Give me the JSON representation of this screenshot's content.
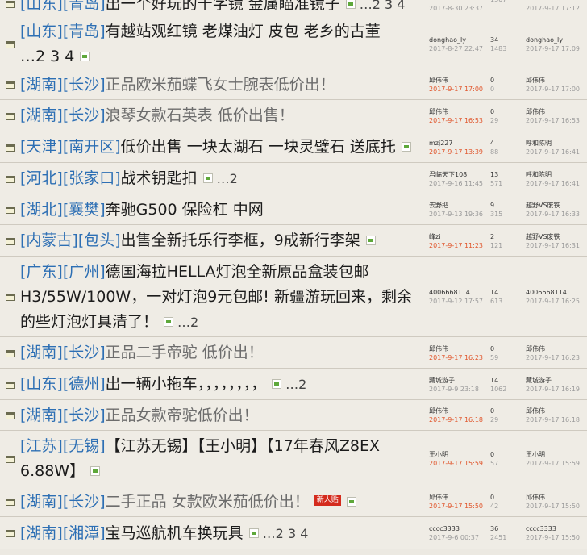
{
  "threads": [
    {
      "regions": [
        "[山东]",
        "[青岛]"
      ],
      "lines": [
        "出一个好玩的千字镜 金属瞄准镜子"
      ],
      "img": true,
      "pages": "…2 3 4",
      "author": "",
      "post_date": "2017-8-30 23:37",
      "post_date_today": false,
      "replies": "",
      "views": "1367",
      "last_author": "",
      "last_date": "2017-9-17 17:12"
    },
    {
      "regions": [
        "[山东]",
        "[青岛]"
      ],
      "lines": [
        "有越站观红镜 老煤油灯 皮包 老乡的古董",
        "…2 3 4"
      ],
      "img": true,
      "pages": "",
      "author": "donghao_ly",
      "post_date": "2017-8-27 22:47",
      "post_date_today": false,
      "replies": "34",
      "views": "1483",
      "last_author": "donghao_ly",
      "last_date": "2017-9-17 17:09"
    },
    {
      "regions": [
        "[湖南]",
        "[长沙]"
      ],
      "lines": [
        "正品欧米茄蝶飞女士腕表低价出！"
      ],
      "gray": true,
      "img": false,
      "pages": "",
      "author": "邱伟伟",
      "post_date": "2017-9-17 17:00",
      "post_date_today": true,
      "replies": "0",
      "views": "0",
      "last_author": "邱伟伟",
      "last_date": "2017-9-17 17:00"
    },
    {
      "regions": [
        "[湖南]",
        "[长沙]"
      ],
      "lines": [
        "浪琴女款石英表 低价出售！"
      ],
      "gray": true,
      "img": false,
      "pages": "",
      "author": "邱伟伟",
      "post_date": "2017-9-17 16:53",
      "post_date_today": true,
      "replies": "0",
      "views": "29",
      "last_author": "邱伟伟",
      "last_date": "2017-9-17 16:53"
    },
    {
      "regions": [
        "[天津]",
        "[南开区]"
      ],
      "lines": [
        "低价出售 一块太湖石 一块灵璧石 送底托"
      ],
      "img": true,
      "pages": "",
      "author": "mzj227",
      "post_date": "2017-9-17 13:39",
      "post_date_today": true,
      "replies": "4",
      "views": "88",
      "last_author": "呼和陈明",
      "last_date": "2017-9-17 16:41"
    },
    {
      "regions": [
        "[河北]",
        "[张家口]"
      ],
      "lines": [
        "战术钥匙扣"
      ],
      "img": true,
      "pages": "…2",
      "author": "君临天下108",
      "post_date": "2017-9-16 11:45",
      "post_date_today": false,
      "replies": "13",
      "views": "571",
      "last_author": "呼和陈明",
      "last_date": "2017-9-17 16:41"
    },
    {
      "regions": [
        "[湖北]",
        "[襄樊]"
      ],
      "lines": [
        "奔驰G500 保险杠 中网"
      ],
      "img": false,
      "pages": "",
      "author": "去野把",
      "post_date": "2017-9-13 19:36",
      "post_date_today": false,
      "replies": "9",
      "views": "315",
      "last_author": "越野VS废铁",
      "last_date": "2017-9-17 16:33"
    },
    {
      "regions": [
        "[内蒙古]",
        "[包头]"
      ],
      "lines": [
        "出售全新托乐行李框，9成新行李架"
      ],
      "img": true,
      "pages": "",
      "author": "峰zi",
      "post_date": "2017-9-17 11:23",
      "post_date_today": true,
      "replies": "2",
      "views": "121",
      "last_author": "越野VS废铁",
      "last_date": "2017-9-17 16:31"
    },
    {
      "regions": [
        "[广东]",
        "[广州]"
      ],
      "lines": [
        "德国海拉HELLA灯泡全新原品盒装包邮",
        "H3/55W/100W，一对灯泡9元包邮! 新疆游玩回来，剩余",
        "的些灯泡灯具清了！"
      ],
      "img": true,
      "pages": "…2",
      "author": "4006668114",
      "post_date": "2017-9-12 17:57",
      "post_date_today": false,
      "replies": "14",
      "views": "613",
      "last_author": "4006668114",
      "last_date": "2017-9-17 16:25"
    },
    {
      "regions": [
        "[湖南]",
        "[长沙]"
      ],
      "lines": [
        "正品二手帝驼 低价出！"
      ],
      "gray": true,
      "img": false,
      "pages": "",
      "author": "邱伟伟",
      "post_date": "2017-9-17 16:23",
      "post_date_today": true,
      "replies": "0",
      "views": "59",
      "last_author": "邱伟伟",
      "last_date": "2017-9-17 16:23"
    },
    {
      "regions": [
        "[山东]",
        "[德州]"
      ],
      "lines": [
        "出一辆小拖车，，，，，，，，"
      ],
      "img": true,
      "pages": "…2",
      "author": "藏城游子",
      "post_date": "2017-9-9 23:18",
      "post_date_today": false,
      "replies": "14",
      "views": "1062",
      "last_author": "藏城游子",
      "last_date": "2017-9-17 16:19"
    },
    {
      "regions": [
        "[湖南]",
        "[长沙]"
      ],
      "lines": [
        "正品女款帝驼低价出！"
      ],
      "gray": true,
      "img": false,
      "pages": "",
      "author": "邱伟伟",
      "post_date": "2017-9-17 16:18",
      "post_date_today": true,
      "replies": "0",
      "views": "29",
      "last_author": "邱伟伟",
      "last_date": "2017-9-17 16:18"
    },
    {
      "regions": [
        "[江苏]",
        "[无锡]"
      ],
      "lines": [
        "【江苏无锡】【王小明】【17年春风Z8EX",
        "6.88W】"
      ],
      "img": true,
      "pages": "",
      "author": "王小明",
      "post_date": "2017-9-17 15:59",
      "post_date_today": true,
      "replies": "0",
      "views": "57",
      "last_author": "王小明",
      "last_date": "2017-9-17 15:59"
    },
    {
      "regions": [
        "[湖南]",
        "[长沙]"
      ],
      "lines": [
        "二手正品 女款欧米茄低价出！"
      ],
      "gray": true,
      "img": true,
      "new_badge": "新人贴",
      "pages": "",
      "author": "邱伟伟",
      "post_date": "2017-9-17 15:50",
      "post_date_today": true,
      "replies": "0",
      "views": "42",
      "last_author": "邱伟伟",
      "last_date": "2017-9-17 15:50"
    },
    {
      "regions": [
        "[湖南]",
        "[湘潭]"
      ],
      "lines": [
        "宝马巡航机车换玩具"
      ],
      "img": true,
      "pages": "…2 3 4",
      "author": "cccc3333",
      "post_date": "2017-9-6 00:37",
      "post_date_today": false,
      "replies": "36",
      "views": "2451",
      "last_author": "cccc3333",
      "last_date": "2017-9-17 15:50"
    }
  ]
}
